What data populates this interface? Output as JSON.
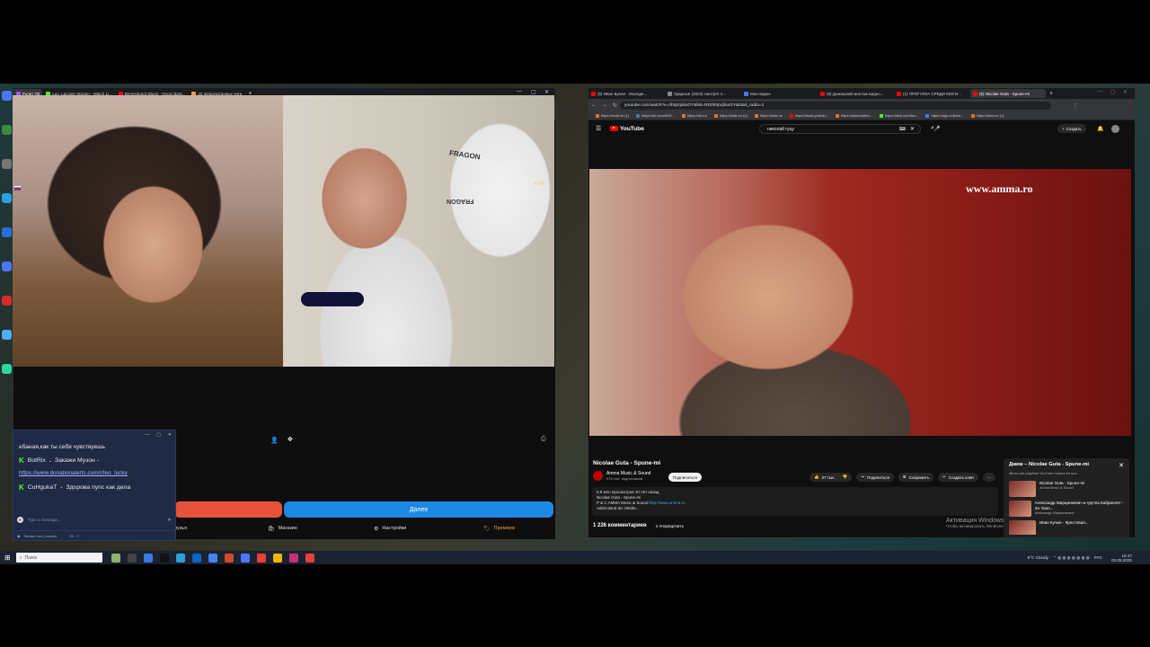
{
  "left_browser": {
    "tabs": [
      {
        "label": "Рулет ТВ",
        "color": "#9a5cff",
        "active": true
      },
      {
        "label": "Leo_Lacoste Stream - Watch Li...",
        "color": "#53fc18"
      },
      {
        "label": "Benneduscit Blues - Oscar Bent...",
        "color": "#ff0000"
      },
      {
        "label": "22 непрочитанных чата",
        "color": "#e8a33a"
      }
    ],
    "url": "ruletka.tv",
    "bookmarks": [
      {
        "label": "https://mail.ru/ (5)",
        "color": "#e8732a"
      },
      {
        "label": "https://vk.com/ld?ft...",
        "color": "#4a76a8"
      },
      {
        "label": "https://ok.ru/",
        "color": "#e8732a"
      },
      {
        "label": "https://twitch.tv/ (5)",
        "color": "#e8732a"
      },
      {
        "label": "https://youtu.be/...",
        "color": "#e8732a"
      },
      {
        "label": "https://www.youtub...",
        "color": "#ff0000"
      },
      {
        "label": "https://www.twitch...",
        "color": "#e8732a"
      },
      {
        "label": "https://kick.com/leo...",
        "color": "#53fc18"
      },
      {
        "label": "https://app.onlinea...",
        "color": "#4a76ff"
      },
      {
        "label": "https://twitch.tv/...",
        "color": "#e8732a"
      }
    ]
  },
  "ruletka": {
    "star_count": "25",
    "chair_brand": "FRAGON",
    "next_button": "Далее",
    "menu": {
      "friends": "рузья",
      "shop": "Магазин",
      "settings": "Настройки",
      "premium": "Премиум"
    }
  },
  "chat": {
    "first_message": "ебаная,как ты себя чувствуешь",
    "messages": [
      {
        "user": "BotRix",
        "text": "Закажи Музон -"
      },
      {
        "user": "CuHgukaT",
        "text": "Здорова пупс как дела"
      }
    ],
    "link": "https://www.donationalerts.com/r/leo_lucky",
    "input_placeholder": "Type a message...",
    "footer": "Stream Leo_Lacoste",
    "footer_counts": "93 · 7"
  },
  "right_browser": {
    "tabs": [
      {
        "label": "(5) Иван Бунин - Молоде...",
        "color": "#ff0000"
      },
      {
        "label": "Ударные (2023) смотрят о...",
        "color": "#888888"
      },
      {
        "label": "Мои видео",
        "color": "#4a76ff"
      },
      {
        "label": "(5) Домашний монтаж видео...",
        "color": "#ff0000"
      },
      {
        "label": "(1) ПРОГУЛКА СРЕДИ МОГИ...",
        "color": "#ff0000"
      },
      {
        "label": "(5) Nicolae Guta - Spune-mi",
        "color": "#ff0000",
        "active": true
      }
    ],
    "url": "youtube.com/watch?v=0htqVjdsxGY&list=RD0htqVjdsxGY&start_radio=1",
    "bookmarks": [
      {
        "label": "https://mail.ru/ (1)",
        "color": "#e8732a"
      },
      {
        "label": "https://vk.com/id19...",
        "color": "#4a76a8"
      },
      {
        "label": "https://ok.ru/",
        "color": "#e8732a"
      },
      {
        "label": "https://web.ru/ (1)",
        "color": "#e8732a"
      },
      {
        "label": "https://web.ru/",
        "color": "#e8732a"
      },
      {
        "label": "https://www.youtub...",
        "color": "#ff0000"
      },
      {
        "label": "https://www.twitch...",
        "color": "#e8732a"
      },
      {
        "label": "https://kick.com/leo...",
        "color": "#53fc18"
      },
      {
        "label": "https://app.onlinea...",
        "color": "#4a76ff"
      },
      {
        "label": "https://web.ru/ (1)",
        "color": "#e8732a"
      }
    ]
  },
  "youtube": {
    "logo": "YouTube",
    "search_query": "николай гуцу",
    "create_button": "Создать",
    "watermark": "www.amma.ro",
    "video_title": "Nicolae Guta - Spune-mi",
    "channel": "Amma Music & Sound",
    "subscribers": "974 тыс. подписчиков",
    "subscribe": "Подписаться",
    "likes": "27 тыс.",
    "share": "Поделиться",
    "save": "Сохранить",
    "clip": "Создать клип",
    "description": [
      "5,9 млн просмотров  10 лет назад",
      "Nicolae Guta - Spune-mi",
      "P & C AMMA Music & Sound",
      "Administrat de: Media..."
    ],
    "description_link": "http://www.amma.ro",
    "comments": "1 226 комментариев",
    "sort": "Упорядочить",
    "mix": {
      "title": "Джем – Nicolae Guta - Spune-mi",
      "subtitle": "Mixes are playlists YouTube makes for you",
      "items": [
        {
          "title": "Nicolae Guta - Spune-mi",
          "sub": "Amma Music & Sound"
        },
        {
          "title": "Александр Марцинкевич и группа Кабриолет - За твою...",
          "sub": "Александр Марцинкевич"
        },
        {
          "title": "Иван Кучин - Крестовая...",
          "sub": ""
        }
      ]
    },
    "activate_title": "Активация Windows",
    "activate_sub": "Чтобы активировать Windows..."
  },
  "taskbar": {
    "search": "Поиск",
    "weather": "6°C  Cloudy",
    "lang": "РУС",
    "time": "16:47",
    "date": "03.05.2025"
  }
}
